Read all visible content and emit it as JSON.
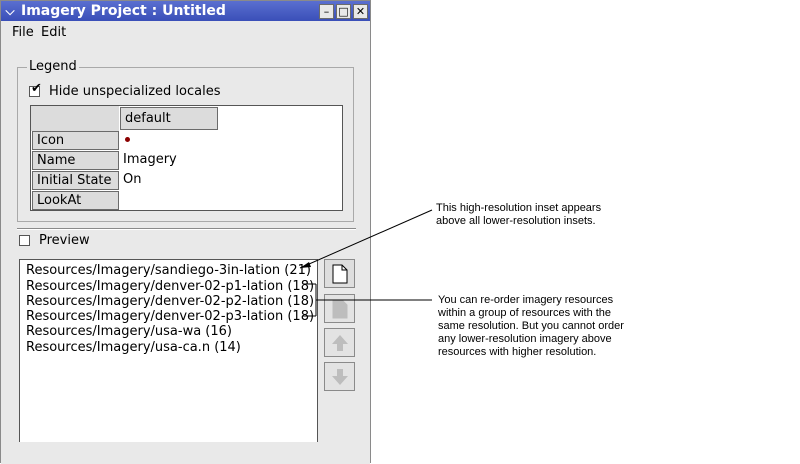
{
  "window": {
    "title": "Imagery Project : Untitled",
    "controls": {
      "menu": "window-menu-icon",
      "minimize": "minimize-icon",
      "maximize": "maximize-icon",
      "close": "close-icon"
    }
  },
  "menubar": {
    "file": "File",
    "edit": "Edit"
  },
  "legend": {
    "group_label": "Legend",
    "hide_unspecialized": {
      "label": "Hide unspecialized locales",
      "checked": true
    },
    "column_header": "default",
    "rows": [
      {
        "label": "Icon",
        "value": ""
      },
      {
        "label": "Name",
        "value": "Imagery"
      },
      {
        "label": "Initial State",
        "value": "On"
      },
      {
        "label": "LookAt",
        "value": ""
      }
    ],
    "icon_color": "#8b0000"
  },
  "preview": {
    "label": "Preview",
    "checked": false
  },
  "resources": [
    "Resources/Imagery/sandiego-3in-lation (21)",
    "Resources/Imagery/denver-02-p1-lation (18)",
    "Resources/Imagery/denver-02-p2-lation (18)",
    "Resources/Imagery/denver-02-p3-lation (18)",
    "Resources/Imagery/usa-wa (16)",
    "Resources/Imagery/usa-ca.n (14)"
  ],
  "side_buttons": [
    "new-document-icon",
    "delete-document-icon",
    "move-up-icon",
    "move-down-icon"
  ],
  "annotations": {
    "top": [
      "This high-resolution inset appears",
      "above all lower-resolution insets."
    ],
    "bottom": [
      "You can re-order imagery resources",
      "within a group of resources with the",
      "same resolution. But you cannot order",
      "any lower-resolution imagery above",
      "resources with higher resolution."
    ]
  },
  "colors": {
    "titlebar": "#3a4fb8",
    "window_bg": "#e9e9e9"
  }
}
